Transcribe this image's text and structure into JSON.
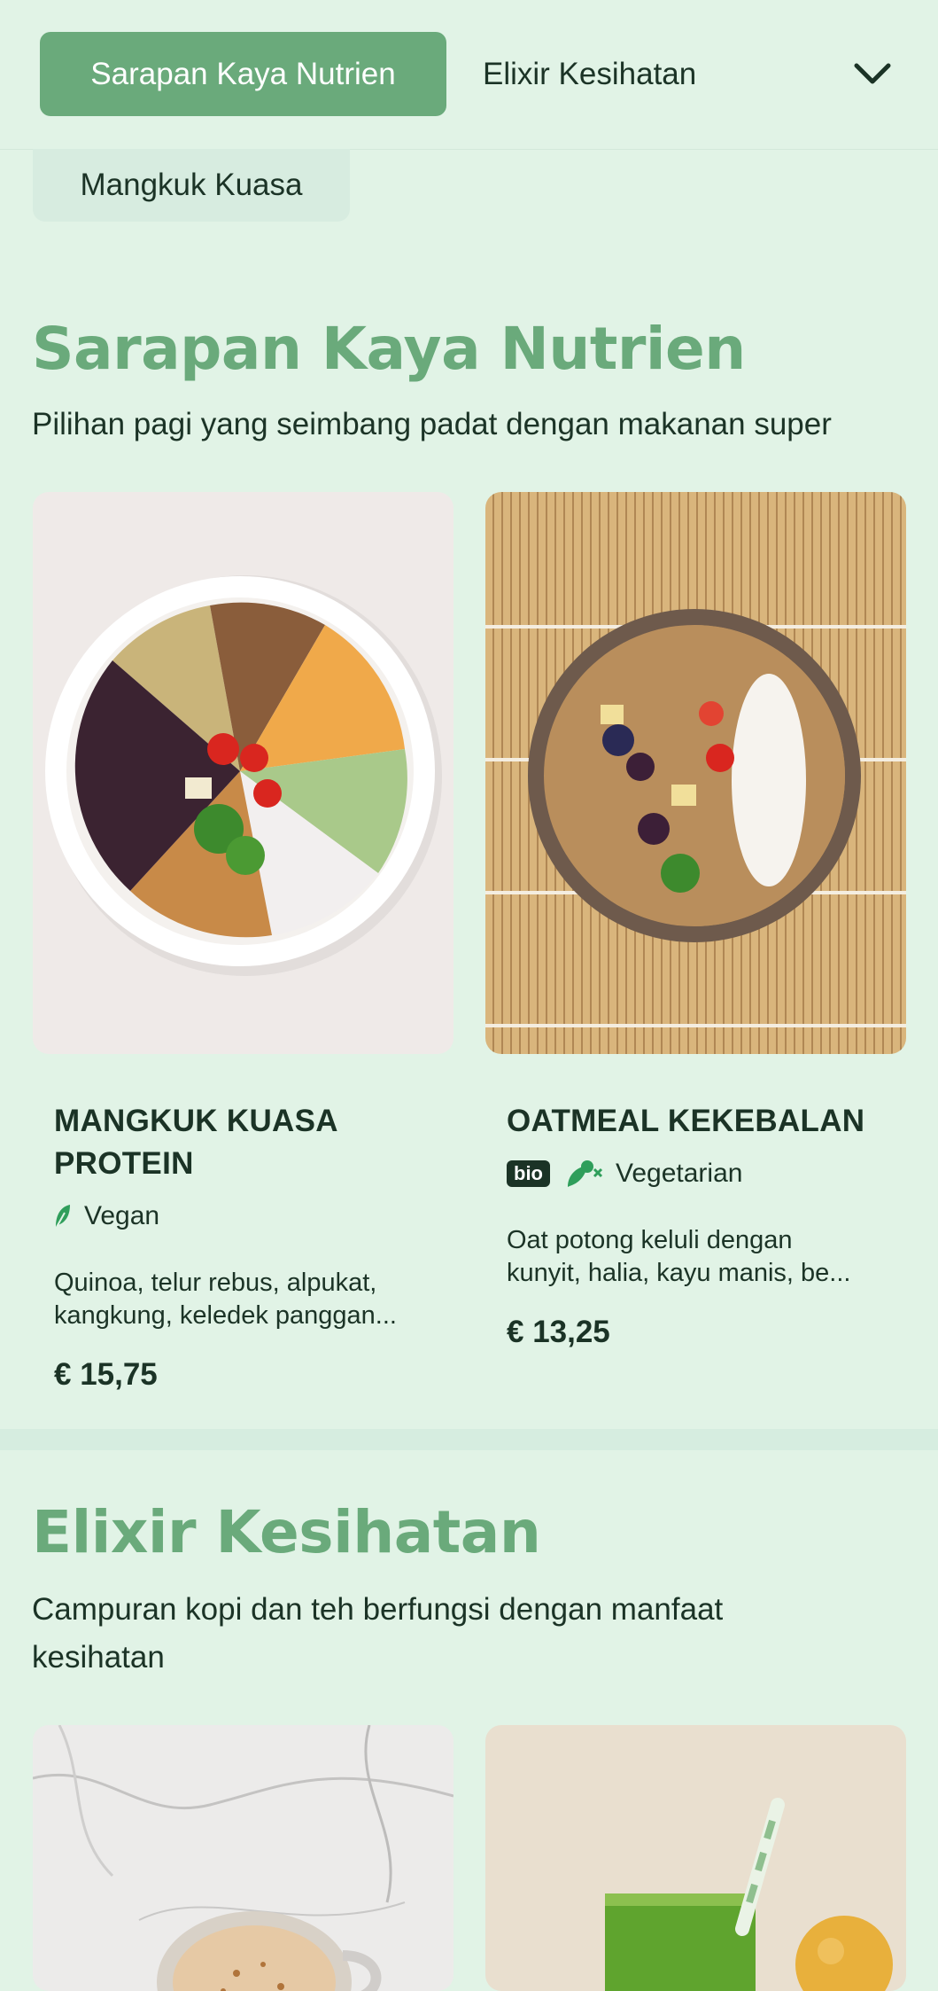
{
  "topbar": {
    "active_chip": "Sarapan Kaya Nutrien",
    "second_chip": "Elixir Kesihatan",
    "overflow_chip": "Mangkuk Kuasa",
    "expand_icon": "chevron-down-icon"
  },
  "sections": [
    {
      "title": "Sarapan Kaya Nutrien",
      "subtitle": "Pilihan pagi yang seimbang padat dengan makanan super",
      "items": [
        {
          "title_line1": "MANGKUK KUASA",
          "title_line2": "PROTEIN",
          "tag": "Vegan",
          "tag_icon": "leaf-icon",
          "desc_line1": "Quinoa, telur rebus, alpukat,",
          "desc_line2": "kangkung, keledek panggan...",
          "price": "€ 15,75",
          "image": "protein-power-bowl-photo"
        },
        {
          "title_line1": "OATMEAL KEKEBALAN",
          "badge": "bio",
          "tag": "Vegetarian",
          "tag_icon": "vegetarian-icon",
          "desc_line1": "Oat potong keluli dengan",
          "desc_line2": "kunyit, halia, kayu manis, be...",
          "price": "€ 13,25",
          "image": "immunity-oatmeal-photo"
        }
      ]
    },
    {
      "title": "Elixir Kesihatan",
      "subtitle_line1": "Campuran kopi dan teh berfungsi dengan manfaat",
      "subtitle_line2": "kesihatan",
      "items": [
        {
          "image": "spiced-latte-photo"
        },
        {
          "image": "green-juice-photo"
        }
      ]
    }
  ],
  "colors": {
    "background": "#e1f3e6",
    "accent": "#6aaa7b",
    "text": "#1b3326",
    "leaf": "#2f9e5b"
  }
}
